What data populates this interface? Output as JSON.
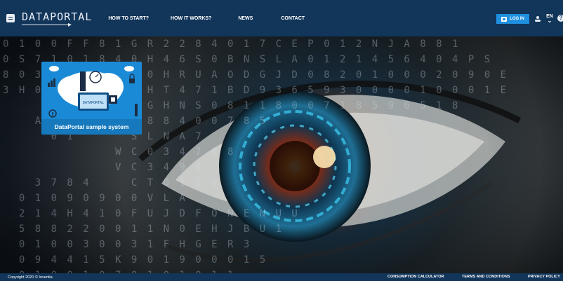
{
  "app": {
    "logo_text": "DATAPORTAL"
  },
  "nav": {
    "items": [
      {
        "label": "HOW TO START?"
      },
      {
        "label": "HOW IT WORKS?"
      },
      {
        "label": "NEWS"
      },
      {
        "label": "CONTACT"
      }
    ]
  },
  "header": {
    "login_label": "LOG IN",
    "language": "EN"
  },
  "hero": {
    "card_title": "DataPortal sample system",
    "card_logo_text": "DATAPORTAL"
  },
  "footer": {
    "copyright": "Copyright 2020 © Inventia",
    "links": [
      {
        "label": "CONSUMPTION CALCULATOR"
      },
      {
        "label": "TERMS AND CONDITIONS"
      },
      {
        "label": "PRIVACY POLICY"
      }
    ]
  },
  "colors": {
    "header_bg": "#12355a",
    "accent": "#1f8fe0",
    "card_bg": "#1b8ad6"
  }
}
